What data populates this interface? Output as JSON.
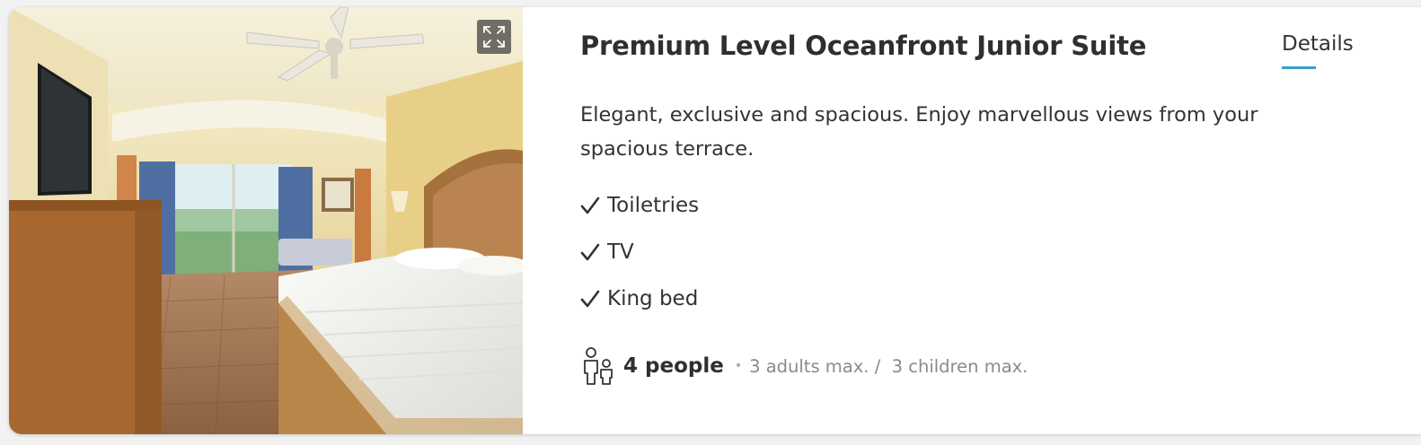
{
  "room": {
    "title": "Premium Level Oceanfront Junior Suite",
    "details_tab": "Details",
    "description": "Elegant, exclusive and spacious. Enjoy marvellous views from your spacious terrace.",
    "amenities": [
      {
        "label": "Toiletries",
        "icon": "check-icon"
      },
      {
        "label": "TV",
        "icon": "check-icon"
      },
      {
        "label": "King bed",
        "icon": "check-icon"
      }
    ],
    "occupancy": {
      "icon": "people-icon",
      "people": "4 people",
      "separator": "•",
      "detail": "3 adults max. /  3 children max."
    }
  },
  "photo": {
    "expand_icon": "expand-icon"
  },
  "colors": {
    "accent": "#3a9fc7",
    "text_primary": "#2f2f2f",
    "text_secondary": "#8a8a8a"
  }
}
